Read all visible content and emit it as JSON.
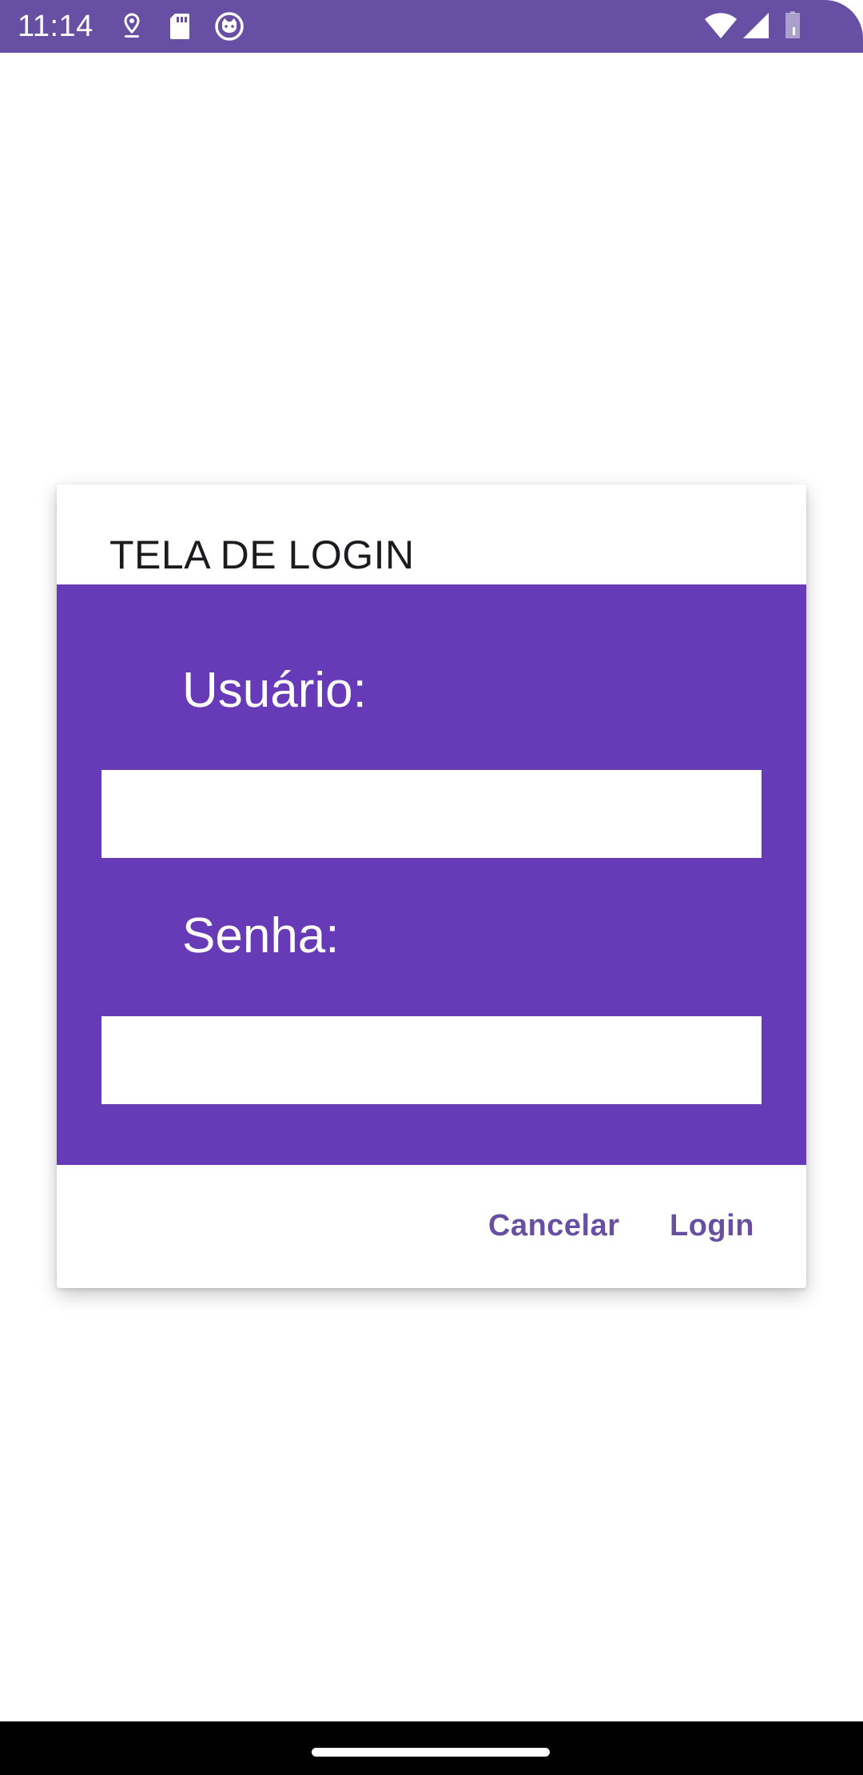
{
  "status_bar": {
    "time": "11:14",
    "icons": [
      "location-pin-icon",
      "sd-card-icon",
      "cat-face-icon",
      "wifi-icon",
      "cellular-signal-icon",
      "battery-icon"
    ],
    "color": "#6750A4"
  },
  "dialog": {
    "title": "TELA DE LOGIN",
    "body_color": "#673AB7",
    "username_label": "Usuário:",
    "username_value": "",
    "password_label": "Senha:",
    "password_value": "",
    "cancel_label": "Cancelar",
    "login_label": "Login",
    "action_color": "#6750A4"
  }
}
